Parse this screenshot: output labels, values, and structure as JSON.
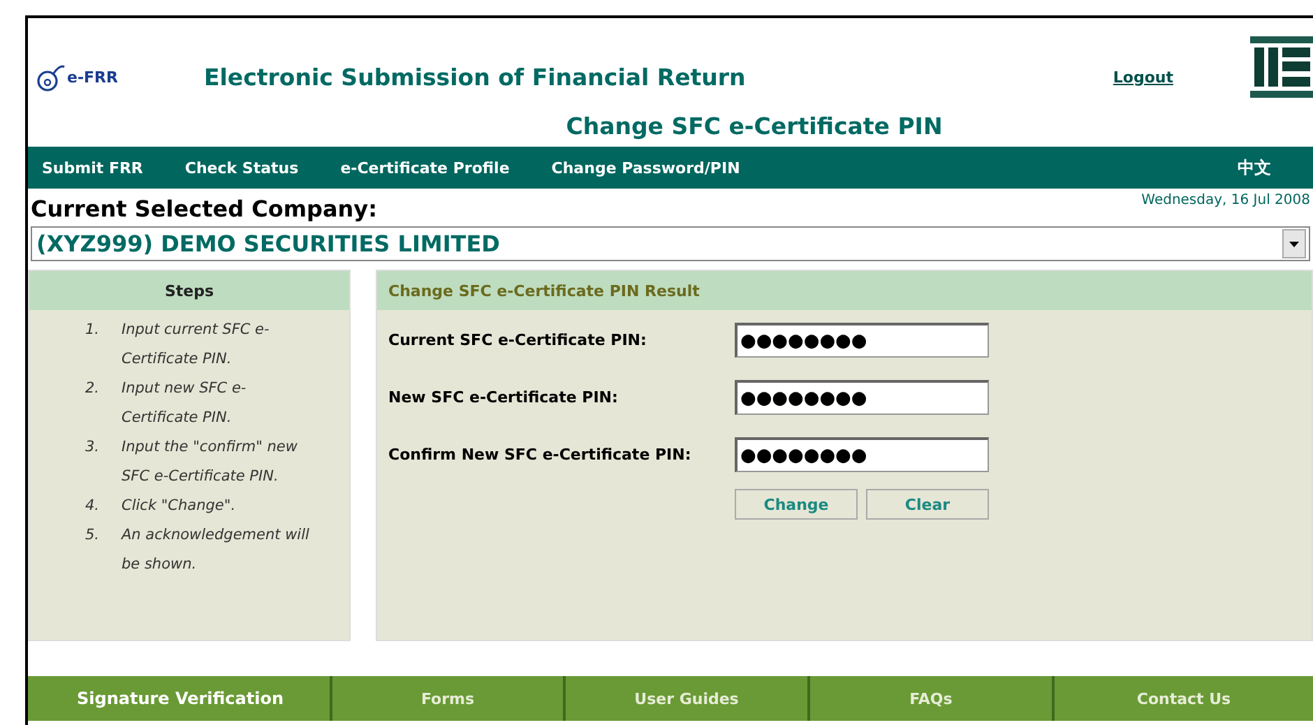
{
  "header": {
    "logo_text": "e-FRR",
    "title": "Electronic Submission of Financial Return",
    "logout": "Logout",
    "page_title": "Change SFC e-Certificate PIN"
  },
  "nav": [
    {
      "label": "Submit FRR"
    },
    {
      "label": "Check Status"
    },
    {
      "label": "e-Certificate Profile"
    },
    {
      "label": "Change Password/PIN"
    }
  ],
  "language": "中文",
  "company": {
    "label": "Current Selected Company:",
    "date": "Wednesday, 16 Jul 2008",
    "selected": "(XYZ999) DEMO SECURITIES LIMITED"
  },
  "steps": {
    "title": "Steps",
    "items": [
      {
        "number": "1.",
        "text": "Input current SFC e-Certificate PIN."
      },
      {
        "number": "2.",
        "text": "Input new SFC e-Certificate PIN."
      },
      {
        "number": "3.",
        "text": "Input the \"confirm\" new SFC e-Certificate PIN."
      },
      {
        "number": "4.",
        "text": "Click \"Change\"."
      },
      {
        "number": "5.",
        "text": "An acknowledgement will be shown."
      }
    ]
  },
  "form": {
    "title": "Change SFC e-Certificate PIN Result",
    "fields": [
      {
        "label": "Current SFC e-Certificate PIN:",
        "value": "●●●●●●●●"
      },
      {
        "label": "New SFC e-Certificate PIN:",
        "value": "●●●●●●●●"
      },
      {
        "label": "Confirm New SFC e-Certificate PIN:",
        "value": "●●●●●●●●"
      }
    ],
    "buttons": [
      "Change",
      "Clear"
    ]
  },
  "footer": [
    {
      "label": "Signature Verification",
      "selected": true
    },
    {
      "label": "Forms",
      "selected": false
    },
    {
      "label": "User Guides",
      "selected": false
    },
    {
      "label": "FAQs",
      "selected": false
    },
    {
      "label": "Contact Us",
      "selected": false
    }
  ]
}
